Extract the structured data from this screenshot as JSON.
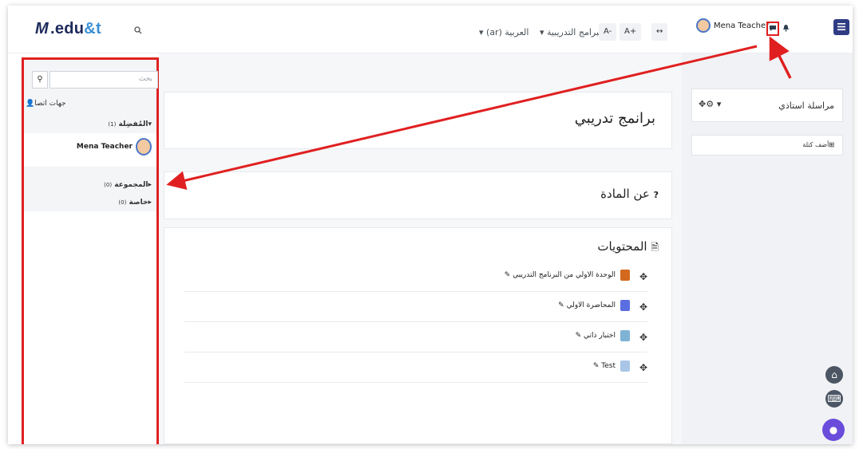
{
  "header": {
    "logo_mark": "M",
    "logo_main": ".edu",
    "logo_accent": "&t",
    "search_icon": "search-icon",
    "menu_programs": "البرامج التدريبية ▾",
    "menu_language": "العربية (ar) ▾",
    "font_decrease": "A-",
    "font_increase": "A+",
    "expand_icon": "↔",
    "user_name": "Mena Teacher",
    "messages_icon": "chat-icon",
    "notifications_icon": "bell-icon",
    "drawer_toggle_icon": "menu-icon"
  },
  "messages_drawer": {
    "search_placeholder": "بحث",
    "contacts_label": "جهات اتصا",
    "starred_label": "المُفضِلة",
    "starred_count": "(1)",
    "contact_name": "Mena Teacher",
    "group_label": "المجموعة",
    "group_count": "(0)",
    "private_label": "خاصة",
    "private_count": "(0)"
  },
  "main": {
    "course_title": "برانمج تدريبي",
    "about_title": "عن المادة",
    "contents_title": "المحتويات",
    "activities": [
      {
        "label": "الوحدة الاولي من البرنامج التدريبي",
        "icon": "book-icon",
        "color": "#d2691e"
      },
      {
        "label": "المحاضرة الاولي",
        "icon": "megaphone-icon",
        "color": "#5b6ee1"
      },
      {
        "label": "اختبار ذاتي",
        "icon": "quiz-icon",
        "color": "#7fb3d5"
      },
      {
        "label": "Test",
        "icon": "lesson-icon",
        "color": "#a9c6e8"
      }
    ]
  },
  "sidebar": {
    "message_teacher": "مراسلة استاذي",
    "add_block": "أضف كتلة"
  },
  "colors": {
    "brand": "#2f3c83",
    "annotation": "#e02020"
  }
}
